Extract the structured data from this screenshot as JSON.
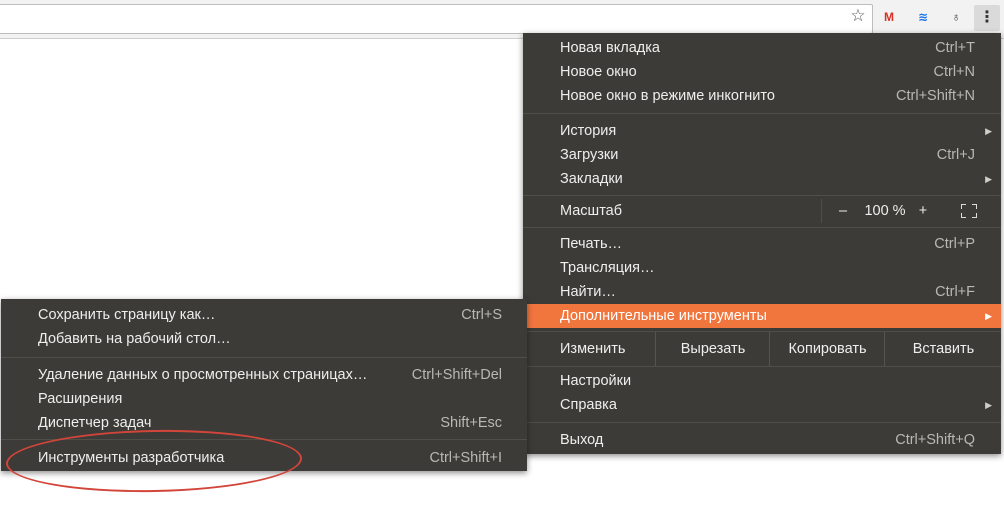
{
  "toolbar": {
    "icons": [
      "star-icon",
      "gmail-icon",
      "sync-extension-icon",
      "lightbulb-extension-icon",
      "kebab-menu-icon"
    ],
    "gmail_glyph": "M",
    "sync_glyph": "≋",
    "bulb_glyph": "♁",
    "star_glyph": "☆",
    "kebab_glyph": "⋮"
  },
  "main_menu": {
    "new_tab": {
      "label": "Новая вкладка",
      "shortcut": "Ctrl+T"
    },
    "new_window": {
      "label": "Новое окно",
      "shortcut": "Ctrl+N"
    },
    "incognito": {
      "label": "Новое окно в режиме инкогнито",
      "shortcut": "Ctrl+Shift+N"
    },
    "history": {
      "label": "История"
    },
    "downloads": {
      "label": "Загрузки",
      "shortcut": "Ctrl+J"
    },
    "bookmarks": {
      "label": "Закладки"
    },
    "zoom": {
      "label": "Масштаб",
      "minus": "–",
      "value": "100 %",
      "plus": "+"
    },
    "print": {
      "label": "Печать…",
      "shortcut": "Ctrl+P"
    },
    "cast": {
      "label": "Трансляция…"
    },
    "find": {
      "label": "Найти…",
      "shortcut": "Ctrl+F"
    },
    "more_tools": {
      "label": "Дополнительные инструменты"
    },
    "edit": {
      "label": "Изменить",
      "cut": "Вырезать",
      "copy": "Копировать",
      "paste": "Вставить"
    },
    "settings": {
      "label": "Настройки"
    },
    "help": {
      "label": "Справка"
    },
    "exit": {
      "label": "Выход",
      "shortcut": "Ctrl+Shift+Q"
    }
  },
  "sub_menu": {
    "save_page": {
      "label": "Сохранить страницу как…",
      "shortcut": "Ctrl+S"
    },
    "add_desktop": {
      "label": "Добавить на рабочий стол…"
    },
    "clear_data": {
      "label": "Удаление данных о просмотренных страницах…",
      "shortcut": "Ctrl+Shift+Del"
    },
    "extensions": {
      "label": "Расширения"
    },
    "task_manager": {
      "label": "Диспетчер задач",
      "shortcut": "Shift+Esc"
    },
    "dev_tools": {
      "label": "Инструменты разработчика",
      "shortcut": "Ctrl+Shift+I"
    }
  },
  "colors": {
    "menu_bg": "#3c3b37",
    "highlight": "#f0763e",
    "annotation": "#d2453a"
  }
}
